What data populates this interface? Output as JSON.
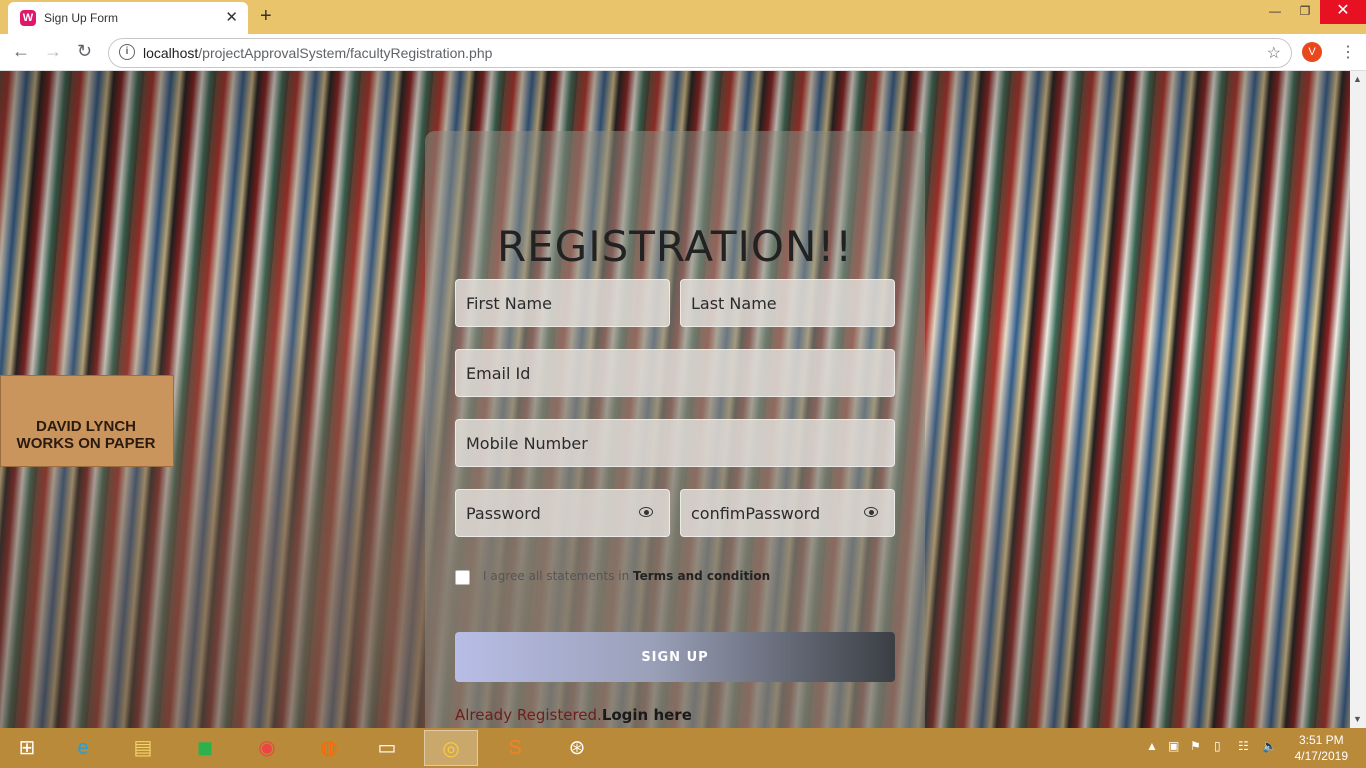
{
  "browser": {
    "tab_title": "Sign Up Form",
    "tab_close": "✕",
    "new_tab": "+",
    "url_host": "localhost",
    "url_path": "/projectApprovalSystem/facultyRegistration.php",
    "profile_initial": "V",
    "window_controls": {
      "minimize": "—",
      "maximize": "❐",
      "close": "✕"
    }
  },
  "background": {
    "sign_text": "DAVID LYNCH\nWORKS ON PAPER"
  },
  "form": {
    "title": "REGISTRATION!!",
    "first_name": "First Name",
    "last_name": "Last Name",
    "email": "Email Id",
    "mobile": "Mobile Number",
    "password": "Password",
    "confirm_password": "confimPassword",
    "agree_text": "I agree all statements in ",
    "terms_link": "Terms and condition",
    "signup_label": "SIGN UP",
    "already_text": "Already Registered.",
    "login_link": "Login here"
  },
  "taskbar": {
    "time": "3:51 PM",
    "date": "4/17/2019"
  },
  "colors": {
    "tabbar": "#e9c46a",
    "taskbar": "#b98a3a",
    "close_red": "#e81123"
  }
}
